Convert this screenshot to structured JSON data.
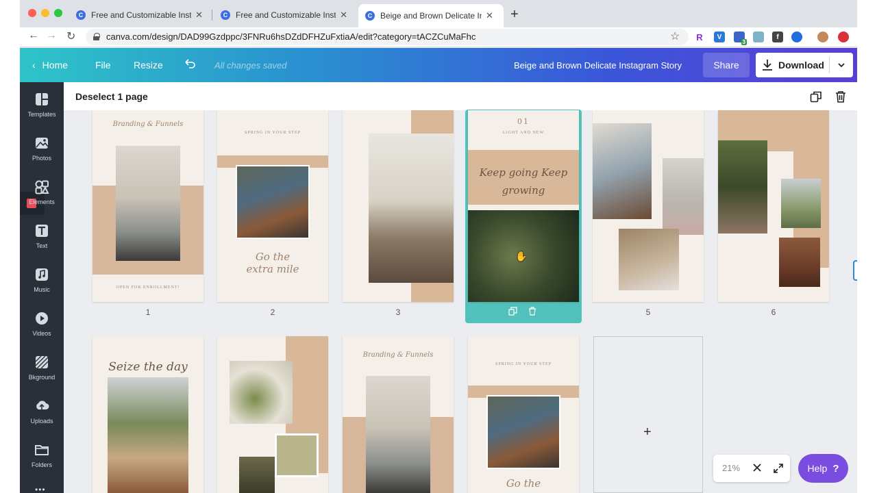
{
  "browser": {
    "tabs": [
      {
        "title": "Free and Customizable Instagram Story Templates"
      },
      {
        "title": "Free and Customizable Instagram Story Templates"
      },
      {
        "title": "Beige and Brown Delicate Instagram Story"
      }
    ],
    "url": "canva.com/design/DAD99Gzdppc/3FNRu6hsDZdDFHZuFxtiaA/edit?category=tACZCuMaFhc",
    "extension_badge": "3"
  },
  "header": {
    "home": "Home",
    "file": "File",
    "resize": "Resize",
    "saved_status": "All changes saved",
    "doc_title": "Beige and Brown Delicate Instagram Story",
    "share": "Share",
    "download": "Download"
  },
  "sidebar": {
    "items": [
      {
        "label": "Templates",
        "icon": "templates-icon"
      },
      {
        "label": "Photos",
        "icon": "photos-icon"
      },
      {
        "label": "Elements",
        "icon": "elements-icon"
      },
      {
        "label": "Text",
        "icon": "text-icon"
      },
      {
        "label": "Music",
        "icon": "music-icon"
      },
      {
        "label": "Videos",
        "icon": "videos-icon"
      },
      {
        "label": "Bkground",
        "icon": "background-icon"
      },
      {
        "label": "Uploads",
        "icon": "uploads-icon"
      },
      {
        "label": "Folders",
        "icon": "folders-icon"
      }
    ]
  },
  "toolbar": {
    "deselect": "Deselect 1 page"
  },
  "pages": {
    "row1": [
      {
        "number": "1",
        "script": "Branding & Funnels",
        "footer": "OPEN FOR ENROLLMENT!"
      },
      {
        "number": "2",
        "top": "SPRING IN YOUR STEP",
        "script": "Go the extra mile"
      },
      {
        "number": "3"
      },
      {
        "number": "",
        "top": "01",
        "sub": "LIGHT AND NEW",
        "script": "Keep going Keep growing"
      },
      {
        "number": "5"
      },
      {
        "number": "6"
      }
    ],
    "row2": [
      {
        "script": "Seize the day"
      },
      {},
      {
        "script": "Branding & Funnels"
      },
      {
        "top": "SPRING IN YOUR STEP",
        "script": "Go the"
      }
    ]
  },
  "zoom": {
    "level": "21%"
  },
  "help": {
    "label": "Help",
    "mark": "?"
  },
  "colors": {
    "accent": "#53c1bb",
    "help": "#7b4ce0",
    "sidebar": "#293039"
  }
}
